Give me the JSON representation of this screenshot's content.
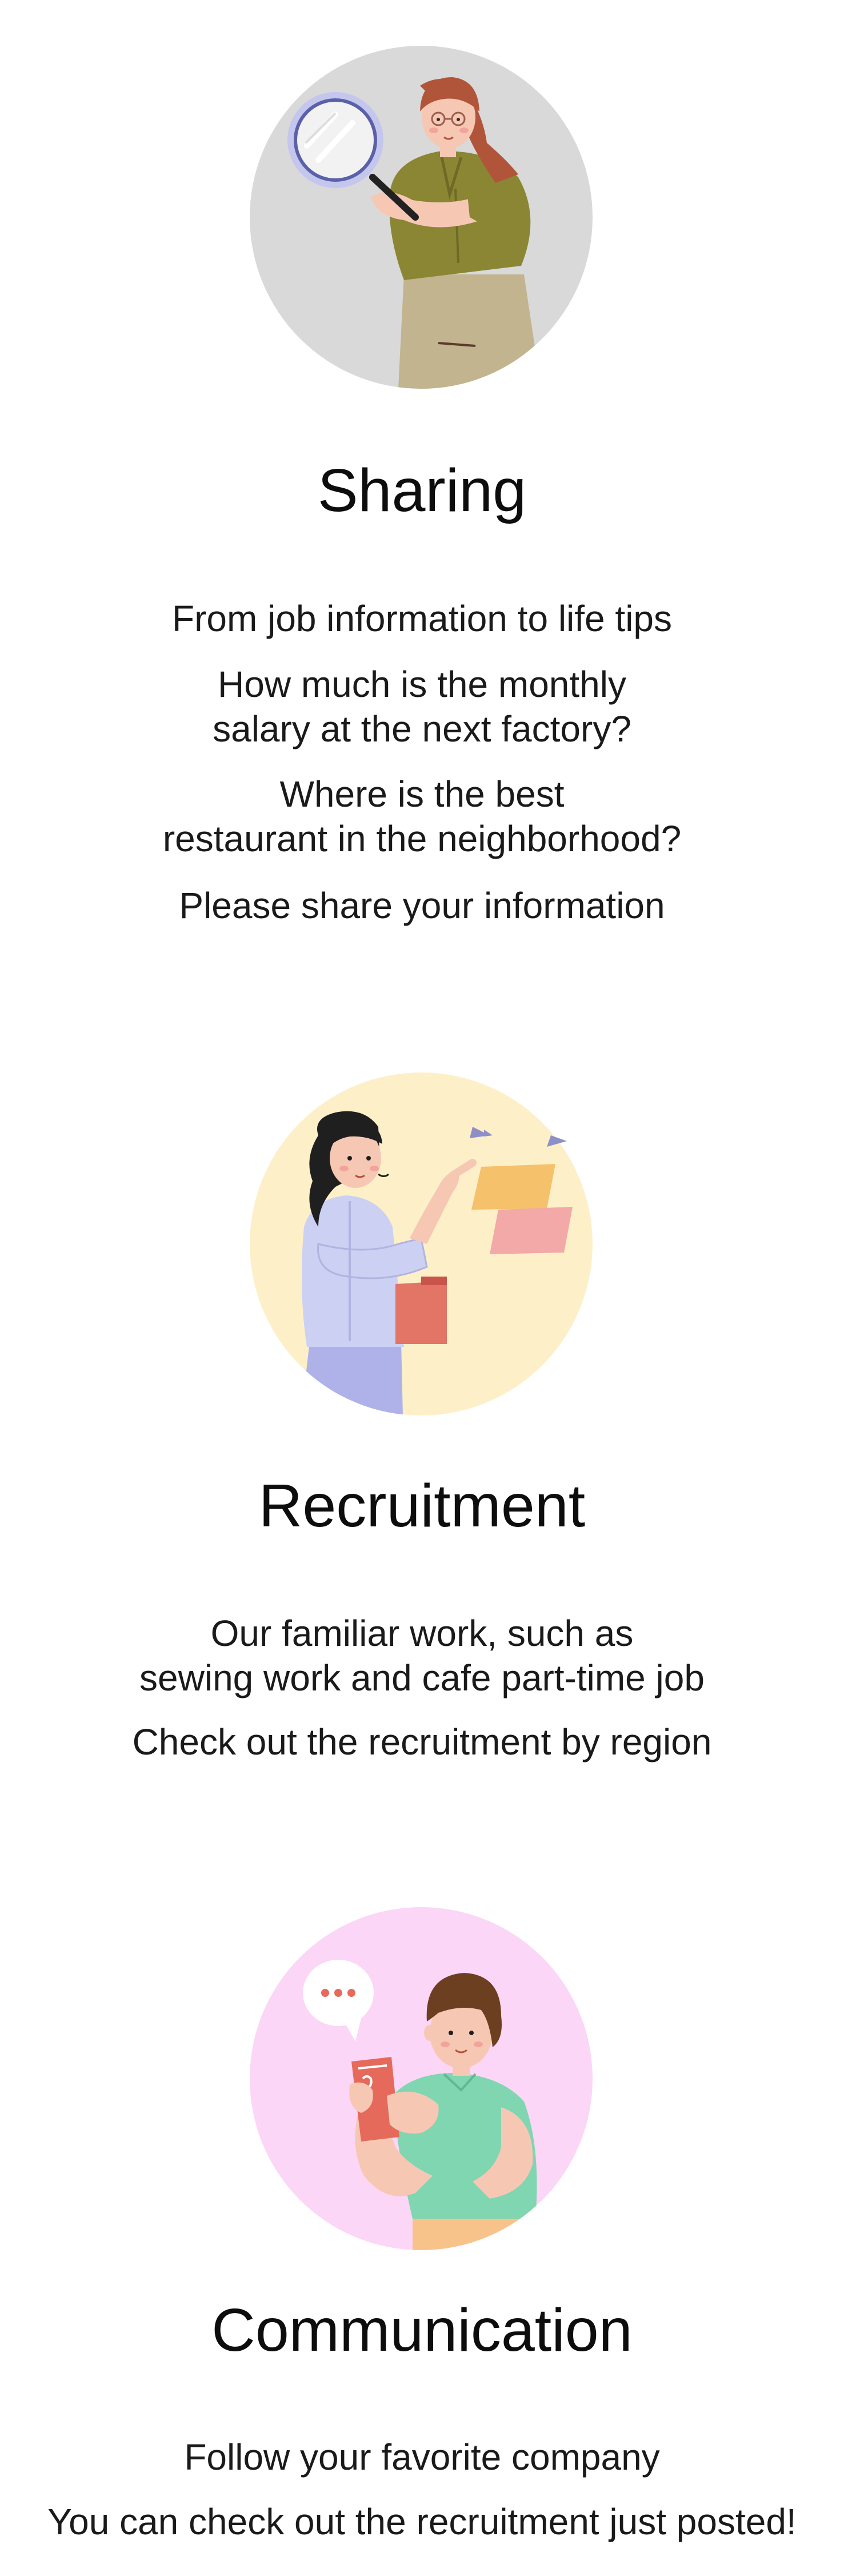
{
  "sections": [
    {
      "illustration": "woman-with-magnifying-glass",
      "bg_color": "#d9d9d9",
      "title": "Sharing",
      "paragraphs": [
        [
          "From job information to life tips"
        ],
        [
          "How much is the monthly",
          "salary at the next factory?"
        ],
        [
          "Where is the best",
          "restaurant in the neighborhood?"
        ],
        [
          "Please share your information"
        ]
      ]
    },
    {
      "illustration": "woman-pointing-at-notes",
      "bg_color": "#fdf0c9",
      "title": "Recruitment",
      "paragraphs": [
        [
          "Our familiar work, such as",
          "sewing work and cafe part-time job"
        ],
        [
          "Check out the recruitment by region"
        ]
      ]
    },
    {
      "illustration": "man-with-phone-and-chat-bubble",
      "bg_color": "#fbd6f6",
      "title": "Communication",
      "paragraphs": [
        [
          "Follow your favorite company"
        ],
        [
          "You can check out the recruitment just posted!"
        ]
      ]
    }
  ]
}
